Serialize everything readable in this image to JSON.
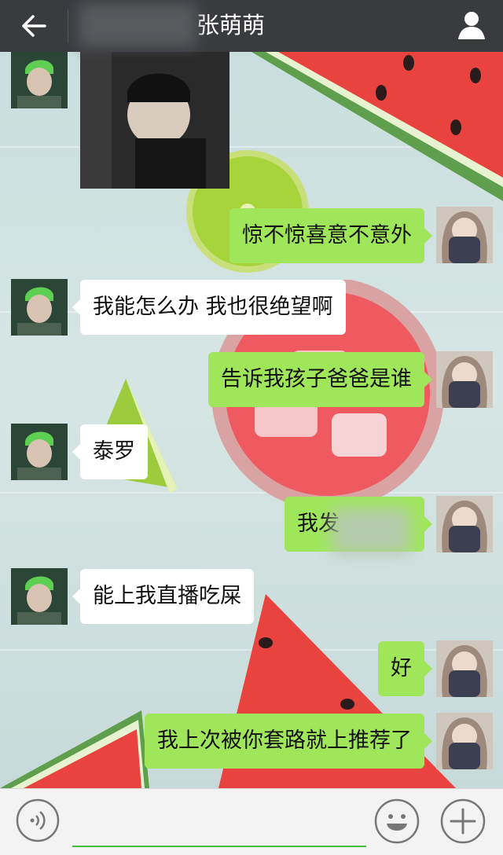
{
  "header": {
    "title": "张萌萌",
    "back_icon": "arrow-left-icon",
    "profile_icon": "person-icon"
  },
  "messages": [
    {
      "side": "left",
      "type": "image",
      "sender_avatar": "joker-avatar"
    },
    {
      "side": "right",
      "type": "text",
      "text": "惊不惊喜意不意外"
    },
    {
      "side": "left",
      "type": "text",
      "text": "我能怎么办 我也很绝望啊"
    },
    {
      "side": "right",
      "type": "text",
      "text": "告诉我孩子爸爸是谁"
    },
    {
      "side": "left",
      "type": "text",
      "text": "泰罗"
    },
    {
      "side": "right",
      "type": "text",
      "text": "我发"
    },
    {
      "side": "left",
      "type": "text",
      "text": "能上我直播吃屎"
    },
    {
      "side": "right",
      "type": "text",
      "text": "好"
    },
    {
      "side": "right",
      "type": "text",
      "text": "我上次被你套路就上推荐了"
    }
  ],
  "input_bar": {
    "voice_icon": "voice-icon",
    "emoji_icon": "smiley-icon",
    "plus_icon": "plus-icon",
    "message_value": ""
  },
  "colors": {
    "topbar": "#3a3b3f",
    "outgoing_bubble": "#9fe65b",
    "incoming_bubble": "#ffffff",
    "input_underline": "#41c03a"
  }
}
